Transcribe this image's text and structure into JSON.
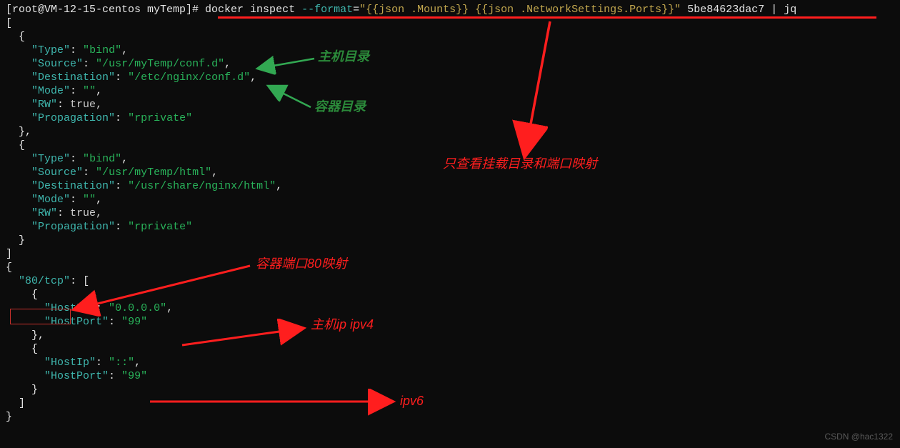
{
  "prompt": {
    "user_host": "[root@VM-12-15-centos myTemp]# ",
    "cmd_docker": "docker inspect ",
    "cmd_flag": "--format",
    "cmd_eq": "=",
    "cmd_arg": "\"{{json .Mounts}} {{json .NetworkSettings.Ports}}\"",
    "cmd_tail": " 5be84623dac7 | jq"
  },
  "mounts": [
    {
      "Type": "bind",
      "Source": "/usr/myTemp/conf.d",
      "Destination": "/etc/nginx/conf.d",
      "Mode": "",
      "RW": "true",
      "Propagation": "rprivate"
    },
    {
      "Type": "bind",
      "Source": "/usr/myTemp/html",
      "Destination": "/usr/share/nginx/html",
      "Mode": "",
      "RW": "true",
      "Propagation": "rprivate"
    }
  ],
  "ports": {
    "key": "80/tcp",
    "list": [
      {
        "HostIp": "0.0.0.0",
        "HostPort": "99"
      },
      {
        "HostIp": "::",
        "HostPort": "99"
      }
    ]
  },
  "annotations": {
    "host_dir": "主机目录",
    "container_dir": "容器目录",
    "only_view": "只查看挂载目录和端口映射",
    "container_port80": "容器端口80映射",
    "host_ip_v4": "主机ip   ipv4",
    "ipv6": "ipv6"
  },
  "watermark": "CSDN @hac1322"
}
